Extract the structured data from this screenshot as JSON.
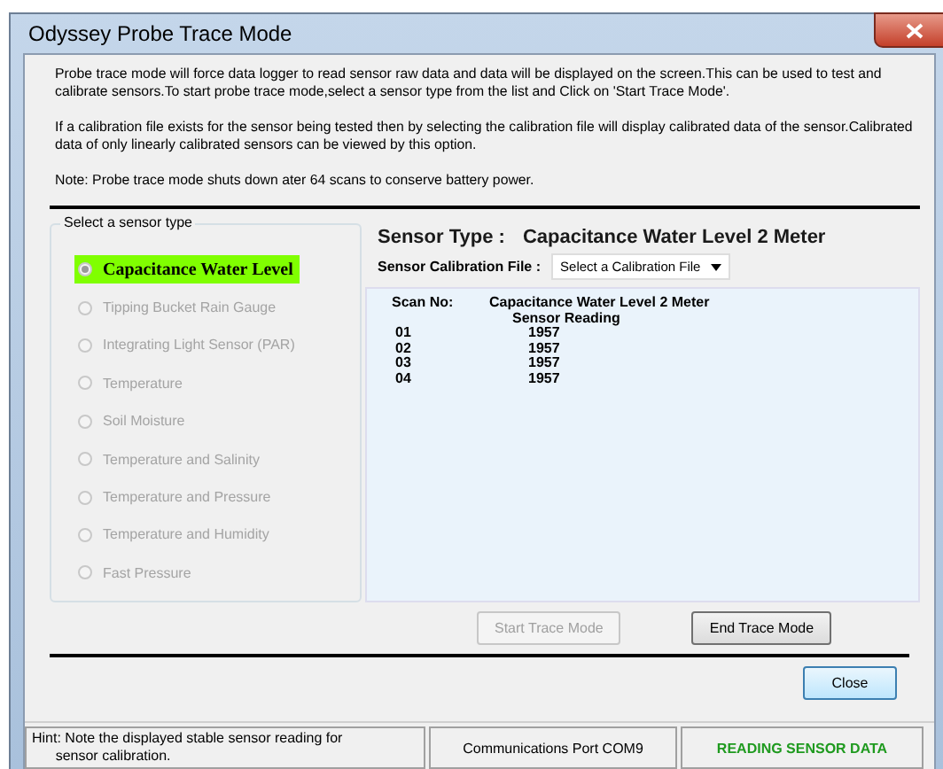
{
  "window": {
    "title": "Odyssey Probe Trace Mode"
  },
  "intro": [
    "Probe trace mode will force data logger to read sensor raw data and data will be displayed on the screen.This can be used to test and calibrate sensors.To start probe trace mode,select a sensor type from the list and Click on 'Start Trace Mode'.",
    "If a calibration file exists for the sensor being tested then by selecting the calibration file will display calibrated data of the sensor.Calibrated data of only linearly calibrated sensors can be viewed by this option.",
    "Note: Probe trace mode shuts down ater 64 scans to conserve battery power."
  ],
  "sensor_group": {
    "title": "Select a sensor type",
    "items": [
      {
        "label": "Capacitance Water Level",
        "selected": true,
        "disabled": false
      },
      {
        "label": "Tipping Bucket Rain Gauge",
        "selected": false,
        "disabled": true
      },
      {
        "label": "Integrating Light Sensor (PAR)",
        "selected": false,
        "disabled": true
      },
      {
        "label": "Temperature",
        "selected": false,
        "disabled": true
      },
      {
        "label": "Soil Moisture",
        "selected": false,
        "disabled": true
      },
      {
        "label": "Temperature and Salinity",
        "selected": false,
        "disabled": true
      },
      {
        "label": "Temperature and Pressure",
        "selected": false,
        "disabled": true
      },
      {
        "label": "Temperature and Humidity",
        "selected": false,
        "disabled": true
      },
      {
        "label": "Fast Pressure",
        "selected": false,
        "disabled": true
      }
    ]
  },
  "sensor_type": {
    "label": "Sensor Type :",
    "value": "Capacitance Water Level 2 Meter"
  },
  "calibration": {
    "label": "Sensor Calibration File :",
    "value": "Select a Calibration File"
  },
  "readings": {
    "scan_header": "Scan No:",
    "reading_header": [
      "Capacitance Water Level  2 Meter",
      "Sensor Reading"
    ],
    "rows": [
      {
        "scan": "01",
        "value": "1957"
      },
      {
        "scan": "02",
        "value": "1957"
      },
      {
        "scan": "03",
        "value": "1957"
      },
      {
        "scan": "04",
        "value": "1957"
      }
    ]
  },
  "buttons": [
    {
      "label": "Start Trace Mode",
      "disabled": true
    },
    {
      "label": "End Trace Mode",
      "disabled": false
    }
  ],
  "close_button": {
    "label": "Close"
  },
  "status_bar": {
    "hint": "Hint: Note the displayed stable sensor reading for\n      sensor calibration.",
    "port": "Communications Port COM9",
    "status": "READING SENSOR DATA"
  }
}
